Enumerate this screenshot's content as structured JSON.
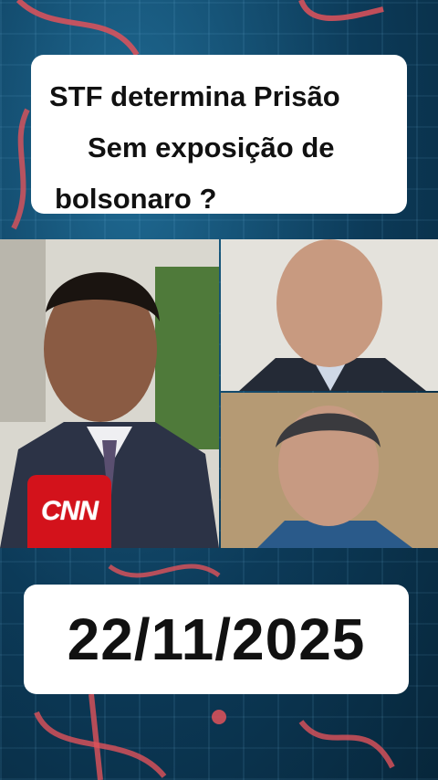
{
  "headline": {
    "line1": "STF determina Prisão",
    "line2": "Sem exposição de",
    "line3": "bolsonaro ?"
  },
  "photos": {
    "reporter_mic_logo": "CNN"
  },
  "date": "22/11/2025",
  "colors": {
    "background": "#0b3550",
    "accent_red": "#d3121b",
    "box": "#ffffff",
    "text": "#111111"
  }
}
